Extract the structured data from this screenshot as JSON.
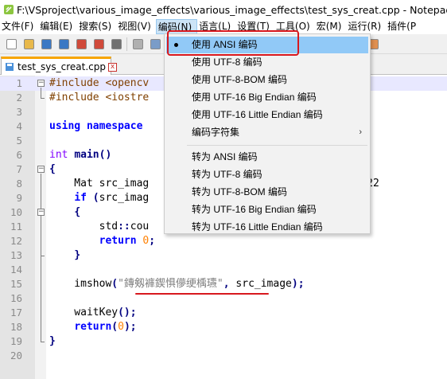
{
  "window": {
    "title": "F:\\VSproject\\various_image_effects\\various_image_effects\\test_sys_creat.cpp - Notepad++ [Ad"
  },
  "menubar": {
    "items": [
      "文件(F)",
      "编辑(E)",
      "搜索(S)",
      "视图(V)",
      "编码(N)",
      "语言(L)",
      "设置(T)",
      "工具(O)",
      "宏(M)",
      "运行(R)",
      "插件(P"
    ],
    "active_index": 4
  },
  "tab": {
    "label": "test_sys_creat.cpp",
    "close_glyph": "x"
  },
  "editor": {
    "lines": [
      {
        "n": "1",
        "html": "<span class=\"pp\">#include &lt;opencv</span>"
      },
      {
        "n": "2",
        "html": "<span class=\"pp\">#include &lt;iostre</span>"
      },
      {
        "n": "3",
        "html": ""
      },
      {
        "n": "4",
        "html": "<span class=\"kw\">using namespace</span>"
      },
      {
        "n": "5",
        "html": ""
      },
      {
        "n": "6",
        "html": "<span class=\"kw2\">int</span> <span class=\"op\">main()</span>"
      },
      {
        "n": "7",
        "html": "<span class=\"op\">{</span>"
      },
      {
        "n": "8",
        "html": "    Mat src_imag                          s/2022/2022"
      },
      {
        "n": "9",
        "html": "    <span class=\"kw\">if</span> <span class=\"op\">(</span>src_imag"
      },
      {
        "n": "10",
        "html": "    <span class=\"op\">{</span>"
      },
      {
        "n": "11",
        "html": "        std<span class=\"op\">::</span>cou                     mage\" <span class=\"op\">&lt;&lt;</span> st"
      },
      {
        "n": "12",
        "html": "        <span class=\"kw\">return</span> <span class=\"num\">0</span><span class=\"op\">;</span>"
      },
      {
        "n": "13",
        "html": "    <span class=\"op\">}</span>"
      },
      {
        "n": "14",
        "html": ""
      },
      {
        "n": "15",
        "html": "    imshow<span class=\"op\">(</span><span class=\"str\">\"鏄剱褲鍥惧儚绠楀瓙\"</span><span class=\"op\">,</span> src_image<span class=\"op\">);</span>"
      },
      {
        "n": "16",
        "html": ""
      },
      {
        "n": "17",
        "html": "    waitKey<span class=\"op\">();</span>"
      },
      {
        "n": "18",
        "html": "    <span class=\"kw\">return</span><span class=\"op\">(</span><span class=\"num\">0</span><span class=\"op\">);</span>"
      },
      {
        "n": "19",
        "html": "<span class=\"op\">}</span>"
      },
      {
        "n": "20",
        "html": ""
      }
    ]
  },
  "encoding_menu": {
    "items": [
      {
        "label": "使用 ANSI 编码",
        "checked": true,
        "hover": true
      },
      {
        "label": "使用 UTF-8 编码"
      },
      {
        "label": "使用 UTF-8-BOM 编码"
      },
      {
        "label": "使用 UTF-16 Big Endian 编码"
      },
      {
        "label": "使用 UTF-16 Little Endian 编码"
      },
      {
        "label": "编码字符集",
        "submenu": true
      },
      {
        "separator": true
      },
      {
        "label": "转为 ANSI 编码"
      },
      {
        "label": "转为 UTF-8 编码"
      },
      {
        "label": "转为 UTF-8-BOM 编码"
      },
      {
        "label": "转为 UTF-16 Big Endian 编码"
      },
      {
        "label": "转为 UTF-16 Little Endian 编码"
      }
    ],
    "submenu_arrow": "›"
  },
  "colors": {
    "highlight_box": "#d8181e",
    "menu_hover": "#91c9f7",
    "tab_accent": "#f7a500"
  },
  "icons": {
    "toolbar": [
      "new-file-icon",
      "open-file-icon",
      "save-icon",
      "save-all-icon",
      "close-icon",
      "close-all-icon",
      "print-icon",
      "cut-icon",
      "copy-icon",
      "paste-icon",
      "undo-icon",
      "redo-icon",
      "find-icon",
      "replace-icon",
      "zoom-in-icon",
      "zoom-out-icon",
      "sync-icon",
      "wrap-icon",
      "show-all-chars-icon",
      "indent-guide-icon",
      "doc-map-icon"
    ]
  }
}
